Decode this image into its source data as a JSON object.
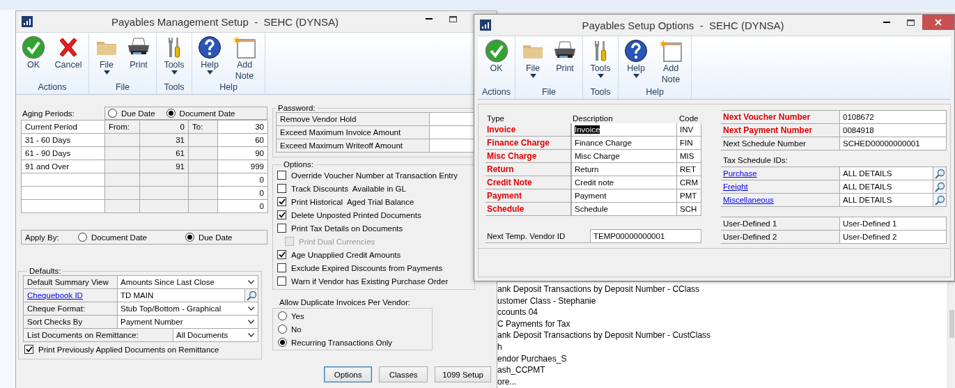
{
  "payables_management_setup": {
    "title": "Payables Management Setup  -  SEHC (DYNSA)",
    "ribbon": [
      {
        "label": "Actions",
        "buttons": [
          {
            "label": "OK",
            "kind": "ok",
            "menu": false
          },
          {
            "label": "Cancel",
            "kind": "cancel",
            "menu": false
          }
        ]
      },
      {
        "label": "File",
        "buttons": [
          {
            "label": "File",
            "kind": "folder",
            "menu": true
          },
          {
            "label": "Print",
            "kind": "printer",
            "menu": false
          }
        ]
      },
      {
        "label": "Tools",
        "buttons": [
          {
            "label": "Tools",
            "kind": "tools",
            "menu": true
          }
        ]
      },
      {
        "label": "Help",
        "buttons": [
          {
            "label": "Help",
            "kind": "help",
            "menu": true
          },
          {
            "label": "Add Note",
            "kind": "note",
            "menu": false
          }
        ]
      }
    ],
    "aging": {
      "label": "Aging Periods:",
      "basis": [
        {
          "label": "Due Date",
          "selected": false
        },
        {
          "label": "Document Date",
          "selected": true
        }
      ],
      "from_label": "From:",
      "to_label": "To:",
      "periods": [
        {
          "name": "Current Period",
          "from": "0",
          "to": "30"
        },
        {
          "name": "31 - 60 Days",
          "from": "31",
          "to": "60"
        },
        {
          "name": "61 - 90 Days",
          "from": "61",
          "to": "90"
        },
        {
          "name": "91 and Over",
          "from": "91",
          "to": "999"
        },
        {
          "to": "0"
        },
        {
          "to": "0"
        },
        {
          "to": "0"
        }
      ]
    },
    "apply_by": {
      "label": "Apply By:",
      "options": [
        {
          "label": "Document Date",
          "selected": false
        },
        {
          "label": "Due Date",
          "selected": true
        }
      ]
    },
    "defaults": {
      "title": "Defaults:",
      "fields": [
        {
          "kind": "dropdown",
          "label": "Default Summary View",
          "value": "Amounts Since Last Close",
          "link": false
        },
        {
          "kind": "lookup",
          "label": "Chequebook ID",
          "value": "TD MAIN",
          "link": true
        },
        {
          "kind": "dropdown",
          "label": "Cheque Format:",
          "value": "Stub Top/Bottom - Graphical",
          "link": false
        },
        {
          "kind": "dropdown",
          "label": "Sort Checks By",
          "value": "Payment Number",
          "link": false
        },
        {
          "kind": "shortdropdown",
          "label": "List Documents on Remittance:",
          "value": "All Documents",
          "link": false
        }
      ],
      "checkbox": {
        "label": "Print Previously Applied Documents on Remittance",
        "checked": true
      }
    },
    "password": {
      "title": "Password:",
      "fields": [
        "Remove Vendor Hold",
        "Exceed Maximum Invoice Amount",
        "Exceed Maximum Writeoff Amount"
      ]
    },
    "options": {
      "title": "Options:",
      "items": [
        {
          "label": "Override Voucher Number at Transaction Entry",
          "checked": false,
          "disabled": false
        },
        {
          "label": "Track Discounts  Available in GL",
          "checked": false,
          "disabled": false
        },
        {
          "label": "Print Historical  Aged Trial Balance",
          "checked": true,
          "disabled": false
        },
        {
          "label": "Delete Unposted Printed Documents",
          "checked": true,
          "disabled": false
        },
        {
          "label": "Print Tax Details on Documents",
          "checked": false,
          "disabled": false,
          "children": [
            {
              "label": "Print Dual Currencies",
              "checked": false,
              "disabled": true
            }
          ]
        },
        {
          "label": "Age Unapplied Credit Amounts",
          "checked": true,
          "disabled": false
        },
        {
          "label": "Exclude Expired Discounts from Payments",
          "checked": false,
          "disabled": false
        },
        {
          "label": "Warn if Vendor has Existing Purchase Order",
          "checked": false,
          "disabled": false
        }
      ]
    },
    "duplicates": {
      "title": "Allow Duplicate Invoices Per Vendor:",
      "options": [
        {
          "label": "Yes",
          "selected": false
        },
        {
          "label": "No",
          "selected": false
        },
        {
          "label": "Recurring Transactions Only",
          "selected": true
        }
      ]
    },
    "buttons": [
      {
        "label": "Options",
        "focused": true
      },
      {
        "label": "Classes",
        "focused": false
      },
      {
        "label": "1099 Setup",
        "focused": false
      }
    ]
  },
  "payables_setup_options": {
    "title": "Payables Setup Options  -  SEHC (DYNSA)",
    "ribbon": [
      {
        "label": "Actions",
        "buttons": [
          {
            "label": "OK",
            "kind": "ok",
            "menu": false
          }
        ]
      },
      {
        "label": "File",
        "buttons": [
          {
            "label": "File",
            "kind": "folder",
            "menu": true
          },
          {
            "label": "Print",
            "kind": "printer",
            "menu": false
          }
        ]
      },
      {
        "label": "Tools",
        "buttons": [
          {
            "label": "Tools",
            "kind": "tools",
            "menu": true
          }
        ]
      },
      {
        "label": "Help",
        "buttons": [
          {
            "label": "Help",
            "kind": "help",
            "menu": true
          },
          {
            "label": "Add Note",
            "kind": "note",
            "menu": false
          }
        ]
      }
    ],
    "types": {
      "columns": [
        "Type",
        "Description",
        "Code"
      ],
      "rows": [
        {
          "type": "Invoice",
          "description": "Invoice",
          "code": "INV",
          "required": true,
          "selected": true
        },
        {
          "type": "Finance Charge",
          "description": "Finance Charge",
          "code": "FIN",
          "required": true,
          "selected": false
        },
        {
          "type": "Misc Charge",
          "description": "Misc Charge",
          "code": "MIS",
          "required": true,
          "selected": false
        },
        {
          "type": "Return",
          "description": "Return",
          "code": "RET",
          "required": true,
          "selected": false
        },
        {
          "type": "Credit Note",
          "description": "Credit note",
          "code": "CRM",
          "required": true,
          "selected": false
        },
        {
          "type": "Payment",
          "description": "Payment",
          "code": "PMT",
          "required": true,
          "selected": false
        },
        {
          "type": "Schedule",
          "description": "Schedule",
          "code": "SCH",
          "required": true,
          "selected": false
        }
      ]
    },
    "next_temp_vendor": {
      "label": "Next Temp. Vendor ID",
      "value": "TEMP00000000001"
    },
    "numbers": [
      {
        "label": "Next Voucher Number",
        "value": "0108672",
        "required": true
      },
      {
        "label": "Next Payment Number",
        "value": "0084918",
        "required": true
      },
      {
        "label": "Next Schedule Number",
        "value": "SCHED00000000001",
        "required": false
      }
    ],
    "tax_schedules": {
      "label": "Tax Schedule IDs:",
      "items": [
        {
          "label": "Purchase",
          "value": "ALL DETAILS"
        },
        {
          "label": "Freight",
          "value": "ALL DETAILS"
        },
        {
          "label": "Miscellaneous",
          "value": "ALL DETAILS"
        }
      ]
    },
    "user_defined": [
      {
        "label": "User-Defined 1",
        "value": "User-Defined 1"
      },
      {
        "label": "User-Defined 2",
        "value": "User-Defined 2"
      }
    ]
  },
  "background_list": {
    "items": [
      "ank Deposit Transactions by Deposit Number - CClass",
      "ustomer Class - Stephanie",
      "ccounts 04",
      "C Payments for Tax",
      "ank Deposit Transactions by Deposit Number - CustClass",
      "h",
      "endor Purchaes_S",
      "ash_CCPMT",
      "ore..."
    ]
  }
}
